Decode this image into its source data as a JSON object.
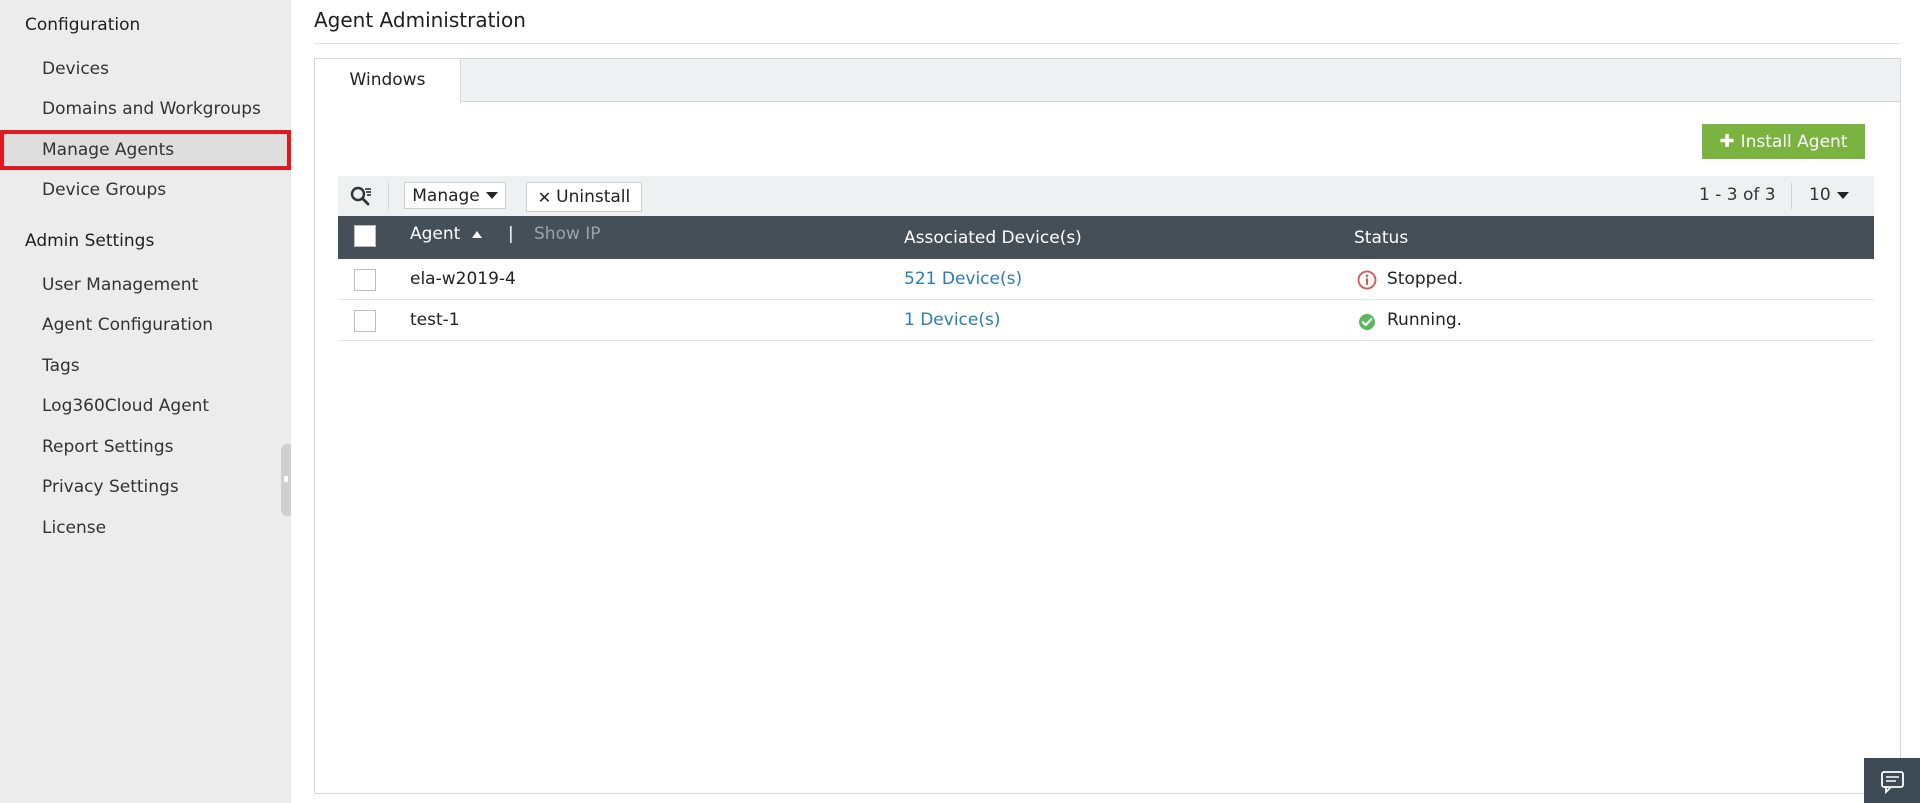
{
  "sidebar": {
    "sections": [
      {
        "title": "Configuration",
        "items": [
          "Devices",
          "Domains and Workgroups",
          "Manage Agents",
          "Device Groups"
        ]
      },
      {
        "title": "Admin Settings",
        "items": [
          "User Management",
          "Agent Configuration",
          "Tags",
          "Log360Cloud Agent",
          "Report Settings",
          "Privacy Settings",
          "License"
        ]
      }
    ],
    "active_item": "Manage Agents"
  },
  "main": {
    "title": "Agent Administration",
    "tabs": [
      {
        "label": "Windows",
        "active": true
      }
    ],
    "install_button": "Install Agent",
    "toolbar": {
      "manage_label": "Manage",
      "uninstall_label": "Uninstall",
      "pager": "1 - 3 of 3",
      "page_size": "10"
    },
    "table": {
      "columns": {
        "agent": "Agent",
        "show_ip": "Show IP",
        "separator": "|",
        "devices": "Associated Device(s)",
        "status": "Status"
      },
      "rows": [
        {
          "agent": "ela-w2019-4",
          "devices": "521 Device(s)",
          "status": "Stopped.",
          "status_kind": "stopped"
        },
        {
          "agent": "test-1",
          "devices": "1 Device(s)",
          "status": "Running.",
          "status_kind": "running"
        }
      ]
    }
  },
  "colors": {
    "accent_green": "#7ab340",
    "header_dark": "#444f58",
    "link_blue": "#2b7bb9",
    "active_outline": "#e0191f",
    "stopped_red": "#d9534f",
    "running_green": "#5cb85c"
  }
}
